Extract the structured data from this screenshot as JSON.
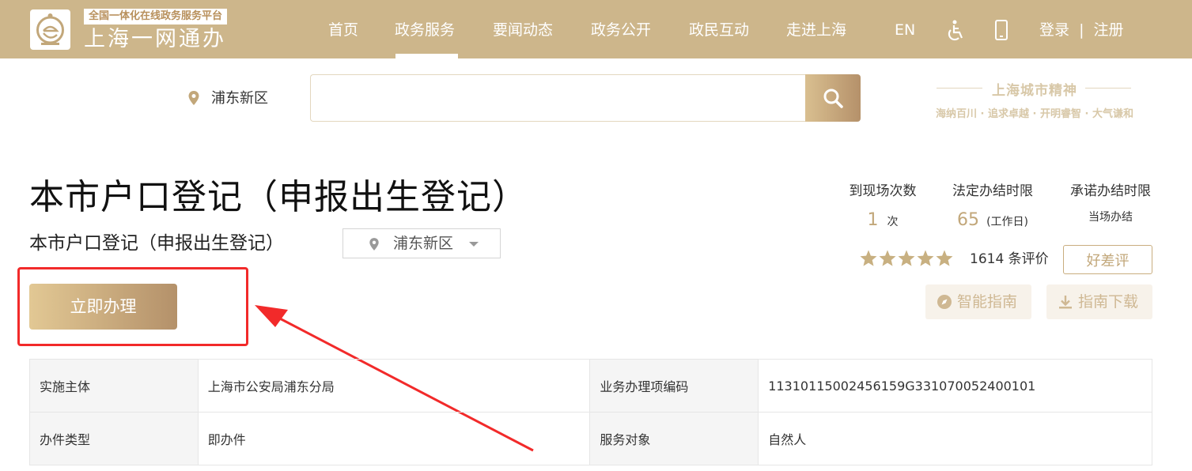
{
  "header": {
    "logo_sub": "全国一体化在线政务服务平台",
    "logo_main": "上海一网通办",
    "nav": [
      "首页",
      "政务服务",
      "要闻动态",
      "政务公开",
      "政民互动",
      "走进上海"
    ],
    "active_nav": "政务服务",
    "lang": "EN",
    "login": "登录",
    "separator": "|",
    "register": "注册"
  },
  "search": {
    "location": "浦东新区",
    "placeholder": ""
  },
  "city_spirit": {
    "title": "上海城市精神",
    "subtitle": "海纳百川 · 追求卓越 · 开明睿智 · 大气谦和"
  },
  "service": {
    "title": "本市户口登记（申报出生登记）",
    "subtitle": "本市户口登记（申报出生登记）",
    "area": "浦东新区",
    "apply_label": "立即办理",
    "stats": {
      "visits_label": "到现场次数",
      "visits_value": "1",
      "visits_unit": "次",
      "legal_label": "法定办结时限",
      "legal_value": "65",
      "legal_unit": "(工作日)",
      "promise_label": "承诺办结时限",
      "promise_value": "当场办结"
    },
    "rating": {
      "stars": 5,
      "count_text": "1614 条评价",
      "rate_button": "好差评"
    },
    "smart_guide": "智能指南",
    "guide_download": "指南下载"
  },
  "info_table": [
    [
      "实施主体",
      "上海市公安局浦东分局",
      "业务办理项编码",
      "11310115002456159G331070052400101"
    ],
    [
      "办件类型",
      "即办件",
      "服务对象",
      "自然人"
    ]
  ],
  "colors": {
    "header_bg": "#cdb68b",
    "accent_gold": "#c2a77a",
    "highlight_red": "#f22a2a"
  }
}
